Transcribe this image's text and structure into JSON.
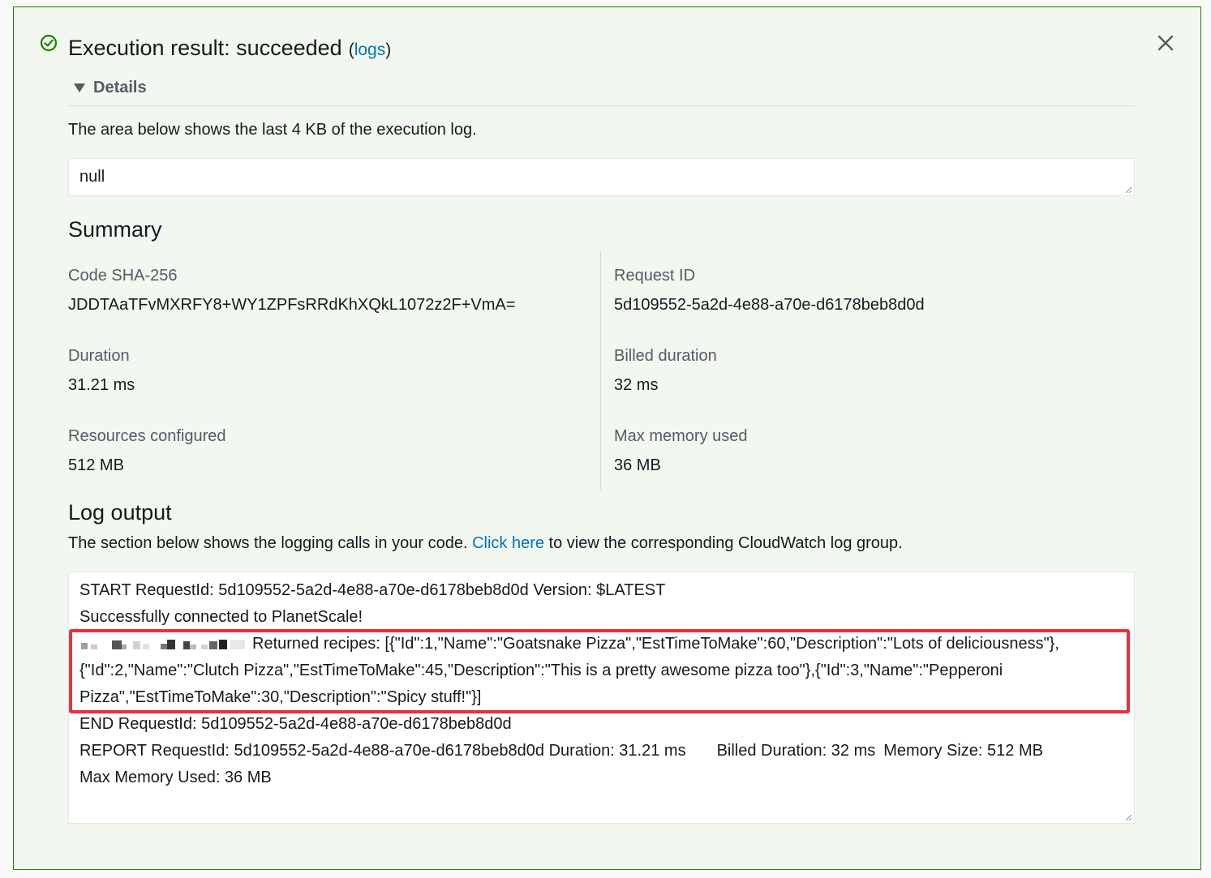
{
  "header": {
    "title": "Execution result: succeeded",
    "logs_open": "(",
    "logs_link": "logs",
    "logs_close": ")",
    "status_color": "#1d8102"
  },
  "details": {
    "toggle_label": "Details",
    "intro": "The area below shows the last 4 KB of the execution log.",
    "result_value": "null"
  },
  "summary": {
    "title": "Summary",
    "fields": [
      {
        "label": "Code SHA-256",
        "value": "JDDTAaTFvMXRFY8+WY1ZPFsRRdKhXQkL1072z2F+VmA="
      },
      {
        "label": "Request ID",
        "value": "5d109552-5a2d-4e88-a70e-d6178beb8d0d"
      },
      {
        "label": "Duration",
        "value": "31.21 ms"
      },
      {
        "label": "Billed duration",
        "value": "32 ms"
      },
      {
        "label": "Resources configured",
        "value": "512 MB"
      },
      {
        "label": "Max memory used",
        "value": "36 MB"
      }
    ]
  },
  "log_output": {
    "title": "Log output",
    "desc_before": "The section below shows the logging calls in your code.",
    "desc_link": "Click here",
    "desc_after": "to view the corresponding CloudWatch log group.",
    "lines": [
      "START RequestId: 5d109552-5a2d-4e88-a70e-d6178beb8d0d Version: $LATEST",
      "Successfully connected to PlanetScale!",
      "Returned recipes: [{\"Id\":1,\"Name\":\"Goatsnake Pizza\",\"EstTimeToMake\":60,\"Description\":\"Lots of deliciousness\"},",
      "{\"Id\":2,\"Name\":\"Clutch Pizza\",\"EstTimeToMake\":45,\"Description\":\"This is a pretty awesome pizza too\"},{\"Id\":3,\"Name\":\"Pepperoni",
      "Pizza\",\"EstTimeToMake\":30,\"Description\":\"Spicy stuff!\"}]",
      "END RequestId: 5d109552-5a2d-4e88-a70e-d6178beb8d0d",
      "REPORT RequestId: 5d109552-5a2d-4e88-a70e-d6178beb8d0d Duration: 31.21 ms",
      "Billed Duration: 32 ms",
      "Memory Size: 512 MB",
      "Max Memory Used: 36 MB"
    ],
    "highlight_color": "#e8303f"
  },
  "icons": {
    "status": "check-circle-icon",
    "close": "close-icon",
    "caret": "caret-down-icon",
    "redacted": "redacted-timestamp-icon"
  },
  "colors": {
    "panel_bg": "#f2f8f0",
    "panel_border": "#1d8102",
    "link": "#0073bb"
  }
}
